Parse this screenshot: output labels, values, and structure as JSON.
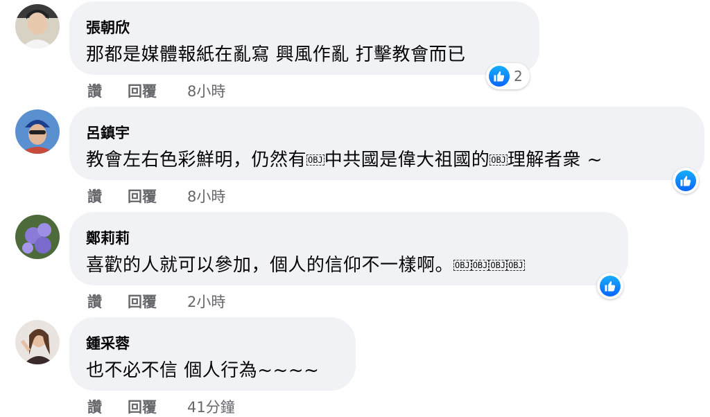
{
  "comments": [
    {
      "author": "張朝欣",
      "text": "那都是媒體報紙在亂寫 興風作亂 打擊教會而已",
      "like_label": "讚",
      "reply_label": "回覆",
      "time": "8小時",
      "reaction_count": "2"
    },
    {
      "author": "呂鎮宇",
      "text_a": "教會左右色彩鮮明，仍然有",
      "text_b": "中共國是偉大祖國的",
      "text_c": "理解者衆 ~",
      "like_label": "讚",
      "reply_label": "回覆",
      "time": "8小時"
    },
    {
      "author": "鄭莉莉",
      "text": "喜歡的人就可以參加，個人的信仰不一樣啊。",
      "like_label": "讚",
      "reply_label": "回覆",
      "time": "2小時"
    },
    {
      "author": "鍾采蓉",
      "text": "也不必不信 個人行為~~~~",
      "like_label": "讚",
      "reply_label": "回覆",
      "time": "41分鐘"
    }
  ],
  "obj_glyph": "OBJ",
  "colors": {
    "bubble": "#f0f2f5",
    "like_blue": "#0866ff",
    "meta_gray": "#65676b"
  }
}
